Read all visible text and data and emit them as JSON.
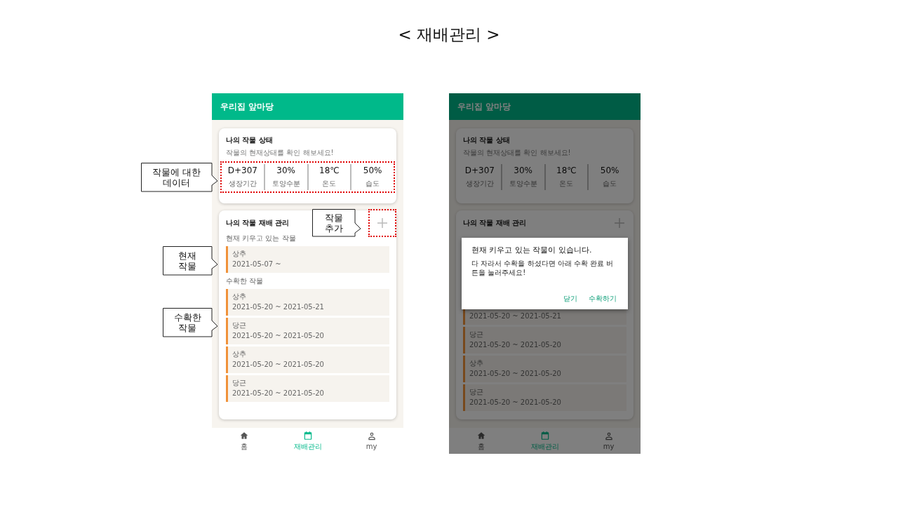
{
  "slide_title": "< 재배관리 >",
  "screens": [
    {
      "app_title": "우리집 앞마당",
      "status_card": {
        "title": "나의 작물 상태",
        "subtitle": "작물의 현재상태를 확인 해보세요!",
        "highlighted": true,
        "stats": [
          {
            "value": "D+307",
            "label": "생장기간"
          },
          {
            "value": "30%",
            "label": "토양수분"
          },
          {
            "value": "18℃",
            "label": "온도"
          },
          {
            "value": "50%",
            "label": "습도"
          }
        ]
      },
      "crop_card": {
        "title": "나의 작물 재배 관리",
        "add_highlighted": true,
        "sections": [
          {
            "heading": "현재 키우고 있는 작물",
            "items": [
              {
                "name": "상추",
                "period": "2021-05-07 ~"
              }
            ]
          },
          {
            "heading": "수확한 작물",
            "items": [
              {
                "name": "상추",
                "period": "2021-05-20 ~ 2021-05-21"
              },
              {
                "name": "당근",
                "period": "2021-05-20 ~ 2021-05-20"
              },
              {
                "name": "상추",
                "period": "2021-05-20 ~ 2021-05-20"
              },
              {
                "name": "당근",
                "period": "2021-05-20 ~ 2021-05-20"
              }
            ]
          }
        ]
      },
      "nav": [
        {
          "kind": "home",
          "label": "홈",
          "selected": false
        },
        {
          "kind": "calendar",
          "label": "재배관리",
          "selected": true
        },
        {
          "kind": "person",
          "label": "my",
          "selected": false
        }
      ]
    },
    {
      "app_title": "우리집 앞마당",
      "status_card": {
        "title": "나의 작물 상태",
        "subtitle": "작물의 현재상태를 확인 해보세요!",
        "stats": [
          {
            "value": "D+307",
            "label": "생장기간"
          },
          {
            "value": "30%",
            "label": "토양수분"
          },
          {
            "value": "18℃",
            "label": "온도"
          },
          {
            "value": "50%",
            "label": "습도"
          }
        ]
      },
      "crop_card": {
        "title": "나의 작물 재배 관리",
        "sections": [
          {
            "items": [
              {
                "period": "2021-05-20 ~ 2021-05-21"
              },
              {
                "name": "당근",
                "period": "2021-05-20 ~ 2021-05-20"
              },
              {
                "name": "상추",
                "period": "2021-05-20 ~ 2021-05-20"
              },
              {
                "name": "당근",
                "period": "2021-05-20 ~ 2021-05-20"
              }
            ]
          }
        ]
      },
      "nav": [
        {
          "kind": "home",
          "label": "홈",
          "selected": false
        },
        {
          "kind": "calendar",
          "label": "재배관리",
          "selected": true
        },
        {
          "kind": "person",
          "label": "my",
          "selected": false
        }
      ],
      "dialog": {
        "message": "현재 키우고 있는 작물이 있습니다.",
        "detail": "다 자라서 수확을 하셨다면 아래 수확 완료 버튼을 눌러주세요!",
        "buttons": [
          "닫기",
          "수확하기"
        ]
      }
    }
  ],
  "callouts": [
    {
      "text": "작물에  대한\n데이터"
    },
    {
      "text": "현재\n작물"
    },
    {
      "text": "수확한\n작물"
    },
    {
      "text": "작물\n추가"
    }
  ]
}
